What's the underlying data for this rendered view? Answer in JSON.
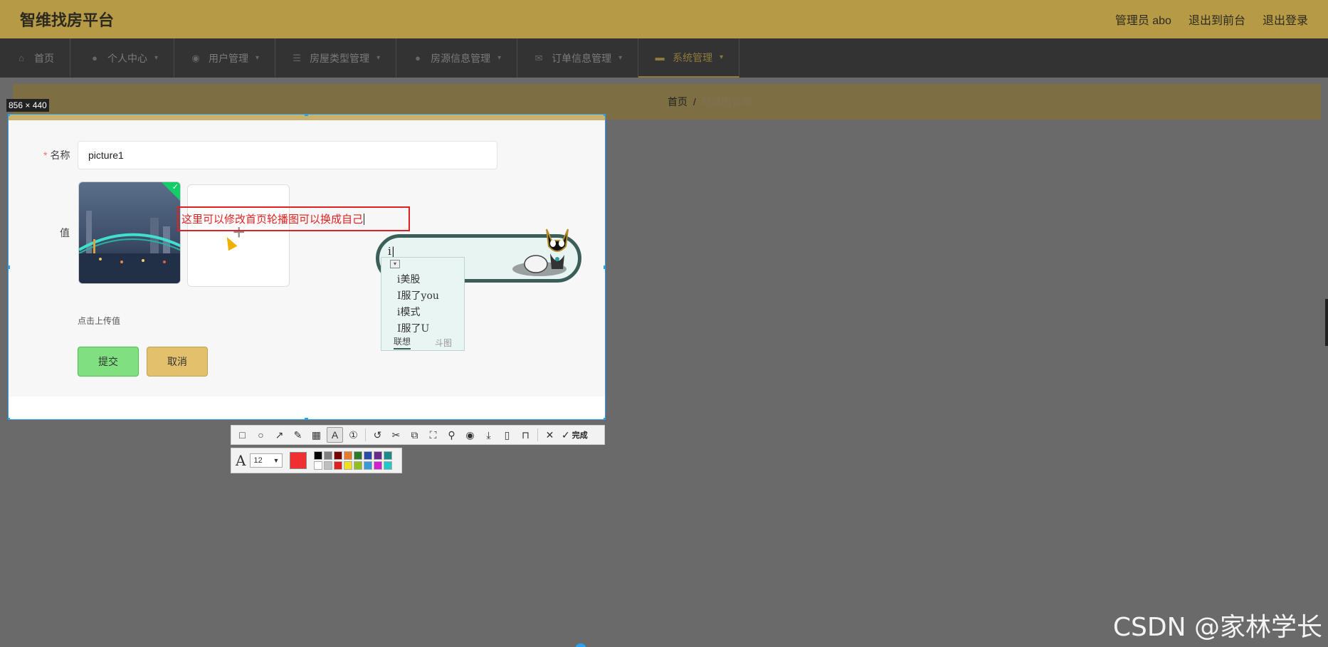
{
  "header": {
    "brand": "智维找房平台",
    "admin": "管理员 abo",
    "front": "退出到前台",
    "logout": "退出登录"
  },
  "nav": [
    {
      "label": "首页",
      "icon": "home-icon",
      "caret": false
    },
    {
      "label": "个人中心",
      "icon": "user-icon",
      "caret": true
    },
    {
      "label": "用户管理",
      "icon": "pin-icon",
      "caret": true
    },
    {
      "label": "房屋类型管理",
      "icon": "list-icon",
      "caret": true
    },
    {
      "label": "房源信息管理",
      "icon": "user-icon",
      "caret": true
    },
    {
      "label": "订单信息管理",
      "icon": "mail-icon",
      "caret": true
    },
    {
      "label": "系统管理",
      "icon": "monitor-icon",
      "caret": true
    }
  ],
  "breadcrumb": {
    "home": "首页",
    "sep": "/",
    "current": "轮播图管理"
  },
  "capture": {
    "size": "856 × 440"
  },
  "form": {
    "name_label": "名称",
    "required_mark": "*",
    "name_value": "picture1",
    "value_label": "值",
    "upload_hint": "点击上传值",
    "submit": "提交",
    "cancel": "取消",
    "plus": "+"
  },
  "annotation": {
    "text": "这里可以修改首页轮播图可以换成自己"
  },
  "ime": {
    "input": "i",
    "candidates": [
      "i美股",
      "I服了you",
      "i模式",
      "I服了U"
    ],
    "tab_active": "联想",
    "tab_inactive": "斗图"
  },
  "toolbar": {
    "done": "完成",
    "font_size": "12"
  },
  "palette": [
    "#000000",
    "#7f7f7f",
    "#7a0000",
    "#e57a2a",
    "#2a7a2a",
    "#2a4aa8",
    "#6a2a8a",
    "#1a8a8a",
    "#ffffff",
    "#bfbfbf",
    "#e02020",
    "#f0e020",
    "#90c020",
    "#3a9ad9",
    "#d020d0",
    "#20c8c8"
  ],
  "colors": {
    "current": "#f03030"
  },
  "watermark": "CSDN @家林学长"
}
